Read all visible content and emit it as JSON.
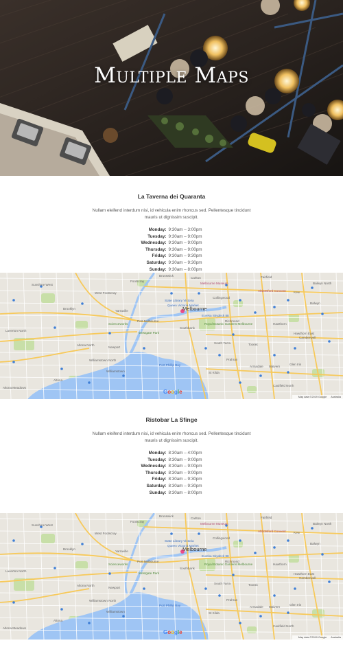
{
  "hero": {
    "title": "Multiple Maps"
  },
  "locations": [
    {
      "name": "La Taverna dei Quaranta",
      "description": "Nullam eleifend interdum nisi, id vehicula enim rhoncus sed. Pellentesque tincidunt mauris ut dignissim suscipit.",
      "hours": [
        {
          "day": "Monday:",
          "time": "9:30am – 3:00pm"
        },
        {
          "day": "Tuesday:",
          "time": "9:30am – 9:00pm"
        },
        {
          "day": "Wednesday:",
          "time": "9:30am – 9:00pm"
        },
        {
          "day": "Thursday:",
          "time": "9:30am – 9:00pm"
        },
        {
          "day": "Friday:",
          "time": "9:30am – 9:30pm"
        },
        {
          "day": "Saturday:",
          "time": "9:30am – 9:30pm"
        },
        {
          "day": "Sunday:",
          "time": "9:30am – 8:00pm"
        }
      ]
    },
    {
      "name": "Ristobar La Sfinge",
      "description": "Nullam eleifend interdum nisi, id vehicula enim rhoncus sed. Pellentesque tincidunt mauris ut dignissim suscipit.",
      "hours": [
        {
          "day": "Monday:",
          "time": "8:30am – 4:00pm"
        },
        {
          "day": "Tuesday:",
          "time": "8:30am – 9:00pm"
        },
        {
          "day": "Wednesday:",
          "time": "8:30am – 9:00pm"
        },
        {
          "day": "Thursday:",
          "time": "8:30am – 9:00pm"
        },
        {
          "day": "Friday:",
          "time": "8:30am – 9:30pm"
        },
        {
          "day": "Saturday:",
          "time": "8:30am – 9:30pm"
        },
        {
          "day": "Sunday:",
          "time": "8:30am – 8:00pm"
        }
      ]
    }
  ],
  "map": {
    "city_label": "Melbourne",
    "places": {
      "melbourne_museum": "Melbourne Museum",
      "abbotsford_convent": "Abbotsford Convent",
      "state_library": "State Library Victoria",
      "queen_victoria_market": "Queen Victoria Market",
      "eureka_skydeck": "Eureka Skydeck 88",
      "royal_botanic": "Royal Botanic Gardens Melbourne",
      "sunshine_west": "Sunshine West",
      "west_footscray": "West Footscray",
      "footscray": "Footscray",
      "brooklyn": "Brooklyn",
      "yarraville": "Yarraville",
      "scienceworks": "Scienceworks",
      "port_melbourne": "Port Melbourne",
      "westgate_park": "Westgate Park",
      "altona_north": "Altona North",
      "newport": "Newport",
      "williamstown_north": "Williamstown North",
      "williamstown": "Williamstown",
      "altona": "Altona",
      "altona_meadows": "Altona Meadows",
      "laverton_north": "Laverton North",
      "carlton": "Carlton",
      "collingwood": "Collingwood",
      "richmond": "Richmond",
      "southbank": "Southbank",
      "south_yarra": "South Yarra",
      "toorak": "Toorak",
      "prahran": "Prahran",
      "st_kilda": "St Kilda",
      "armadale": "Armadale",
      "malvern": "Malvern",
      "glen_iris": "Glen Iris",
      "caulfield_north": "Caulfield North",
      "hawthorn": "Hawthorn",
      "hawthorn_east": "Hawthorn East",
      "camberwell": "Camberwell",
      "kew": "Kew",
      "balwyn": "Balwyn",
      "balwyn_north": "Balwyn North",
      "port_phillip_bay": "Port Phillip Bay",
      "brunswick": "Brunswick",
      "fairfield": "Fairfield"
    },
    "google_letters": [
      "G",
      "o",
      "o",
      "g",
      "l",
      "e"
    ],
    "google_colors": [
      "#4285F4",
      "#EA4335",
      "#FBBC05",
      "#4285F4",
      "#34A853",
      "#EA4335"
    ],
    "footer_data": "Map data ©2019 Google",
    "footer_region": "Australia"
  },
  "colors": {
    "land": "#e9e6df",
    "water": "#9fc5f4",
    "park": "#c8dfa8",
    "major_road": "#f7c95a",
    "minor_road": "#ffffff",
    "cbd_pin": "#ea4c89"
  }
}
